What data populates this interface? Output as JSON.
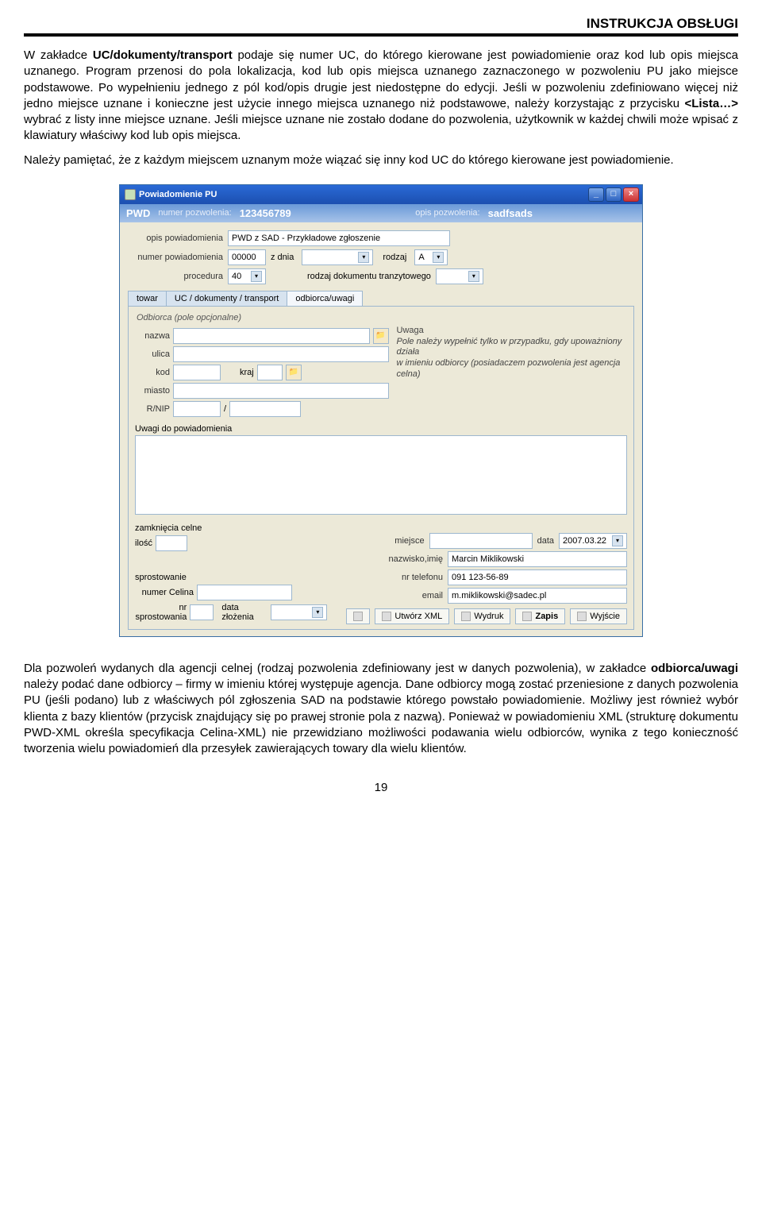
{
  "header": {
    "title": "INSTRUKCJA OBSŁUGI"
  },
  "para1_pre": "W zakładce ",
  "para1_bold1": "UC/dokumenty/transport",
  "para1_post": " podaje się numer UC, do którego kierowane jest powiadomienie oraz kod lub opis miejsca uznanego.",
  "para2": "Program przenosi do pola lokalizacja, kod lub opis miejsca uznanego zaznaczonego w pozwoleniu PU jako miejsce podstawowe. Po wypełnieniu jednego z pól kod/opis drugie jest niedostępne do edycji.",
  "para3_a": "Jeśli w pozwoleniu zdefiniowano więcej niż jedno miejsce uznane i konieczne jest użycie innego miejsca uznanego niż podstawowe, należy korzystając z przycisku ",
  "para3_bold": "<Lista…>",
  "para3_b": " wybrać z listy inne miejsce uznane.",
  "para4": "Jeśli miejsce uznane nie zostało dodane do pozwolenia, użytkownik w każdej chwili może wpisać z klawiatury właściwy kod lub opis miejsca.",
  "para5": "Należy pamiętać, że z każdym miejscem uznanym może wiązać się inny kod UC do którego kierowane jest powiadomienie.",
  "para6_a": "Dla pozwoleń wydanych dla agencji celnej (rodzaj pozwolenia zdefiniowany jest w danych pozwolenia), w zakładce ",
  "para6_bold": "odbiorca/uwagi",
  "para6_b": "  należy podać dane odbiorcy – firmy w imieniu której występuje agencja. Dane odbiorcy mogą zostać przeniesione z danych pozwolenia PU (jeśli podano) lub z właściwych pól zgłoszenia SAD na podstawie którego powstało powiadomienie.",
  "para7": "Możliwy jest również wybór klienta z bazy klientów (przycisk znajdujący się po prawej stronie pola z nazwą).",
  "para8": "Ponieważ w powiadomieniu XML (strukturę dokumentu PWD-XML określa specyfikacja Celina-XML) nie przewidziano możliwości podawania wielu odbiorców, wynika z tego konieczność tworzenia wielu powiadomień dla przesyłek zawierających towary dla wielu klientów.",
  "page_number": "19",
  "window": {
    "title": "Powiadomienie PU",
    "pwd_label": "PWD",
    "numer_pozw_label": "numer pozwolenia:",
    "numer_pozw_value": "123456789",
    "opis_pozw_label": "opis pozwolenia:",
    "opis_pozw_value": "sadfsads",
    "opis_pow_label": "opis powiadomienia",
    "opis_pow_value": "PWD z SAD - Przykładowe zgłoszenie",
    "numer_pow_label": "numer powiadomienia",
    "numer_pow_value": "00000",
    "z_dnia": "z dnia",
    "rodzaj": "rodzaj",
    "rodzaj_value": "A",
    "procedura_label": "procedura",
    "procedura_value": "40",
    "rodzaj_dok_tranz": "rodzaj dokumentu tranzytowego",
    "tab1": "towar",
    "tab2": "UC / dokumenty / transport",
    "tab3": "odbiorca/uwagi",
    "odbiorca_group": "Odbiorca (pole opcjonalne)",
    "uwaga_title": "Uwaga",
    "uwaga_text1": "Pole należy wypełnić tylko w przypadku, gdy upoważniony działa",
    "uwaga_text2": "w imieniu odbiorcy (posiadaczem pozwolenia jest agencja celna)",
    "f_nazwa": "nazwa",
    "f_ulica": "ulica",
    "f_kod": "kod",
    "f_kraj": "kraj",
    "f_miasto": "miasto",
    "f_rnip": "R/NIP",
    "uwagi_label": "Uwagi do powiadomienia",
    "zamkn": "zamknięcia celne",
    "ilosc": "ilość",
    "miejsce": "miejsce",
    "data": "data",
    "data_value": "2007.03.22",
    "nazwisko": "nazwisko,imię",
    "nazwisko_value": "Marcin Miklikowski",
    "telefon": "nr telefonu",
    "telefon_value": "091 123-56-89",
    "email": "email",
    "email_value": "m.miklikowski@sadec.pl",
    "sprost": "sprostowanie",
    "numer_celina": "numer Celina",
    "nr_sprost": "nr sprostowania",
    "data_zloz": "data złożenia",
    "btn_xml": "Utwórz XML",
    "btn_wydruk": "Wydruk",
    "btn_zapis": "Zapis",
    "btn_wyjscie": "Wyjście"
  }
}
